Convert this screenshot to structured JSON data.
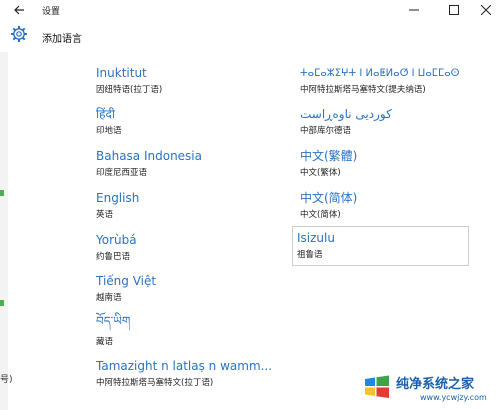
{
  "window": {
    "title": "设置"
  },
  "header": {
    "title": "添加语言"
  },
  "background": {
    "fragment_text": "号)"
  },
  "languages_left": [
    {
      "native": "Inuktitut",
      "zh": "因纽特语(拉丁语)"
    },
    {
      "native": "हिंदी",
      "zh": "印地语"
    },
    {
      "native": "Bahasa Indonesia",
      "zh": "印度尼西亚语"
    },
    {
      "native": "English",
      "zh": "英语"
    },
    {
      "native": "Yorùbá",
      "zh": "约鲁巴语"
    },
    {
      "native": "Tiếng Việt",
      "zh": "越南语"
    },
    {
      "native": "བོད་ཡིག",
      "zh": "藏语"
    },
    {
      "native": "Tamazight n latlaṣ n wamm...",
      "zh": "中阿特拉斯塔马塞特文(拉丁语)"
    }
  ],
  "languages_right": [
    {
      "native": "ⵜⴰⵎⴰⵣⵉⵖⵜ ⵏ ⵍⴰⵟⵍⴰⵚ ⵏ ⵡⴰⵎⵎⴰⵙ",
      "zh": "中阿特拉斯塔马塞特文(提夫纳语)"
    },
    {
      "native": "کوردیی ناوەڕاست",
      "zh": "中部库尔德语"
    },
    {
      "native": "中文(繁體)",
      "zh": "中文(繁体)"
    },
    {
      "native": "中文(简体)",
      "zh": "中文(简体)"
    },
    {
      "native": "Isizulu",
      "zh": "祖鲁语"
    }
  ],
  "watermark": {
    "main": "纯净系统之家",
    "url": "www.ycwjzy.com"
  },
  "colors": {
    "accent": "#2a73c5",
    "text": "#222222"
  }
}
